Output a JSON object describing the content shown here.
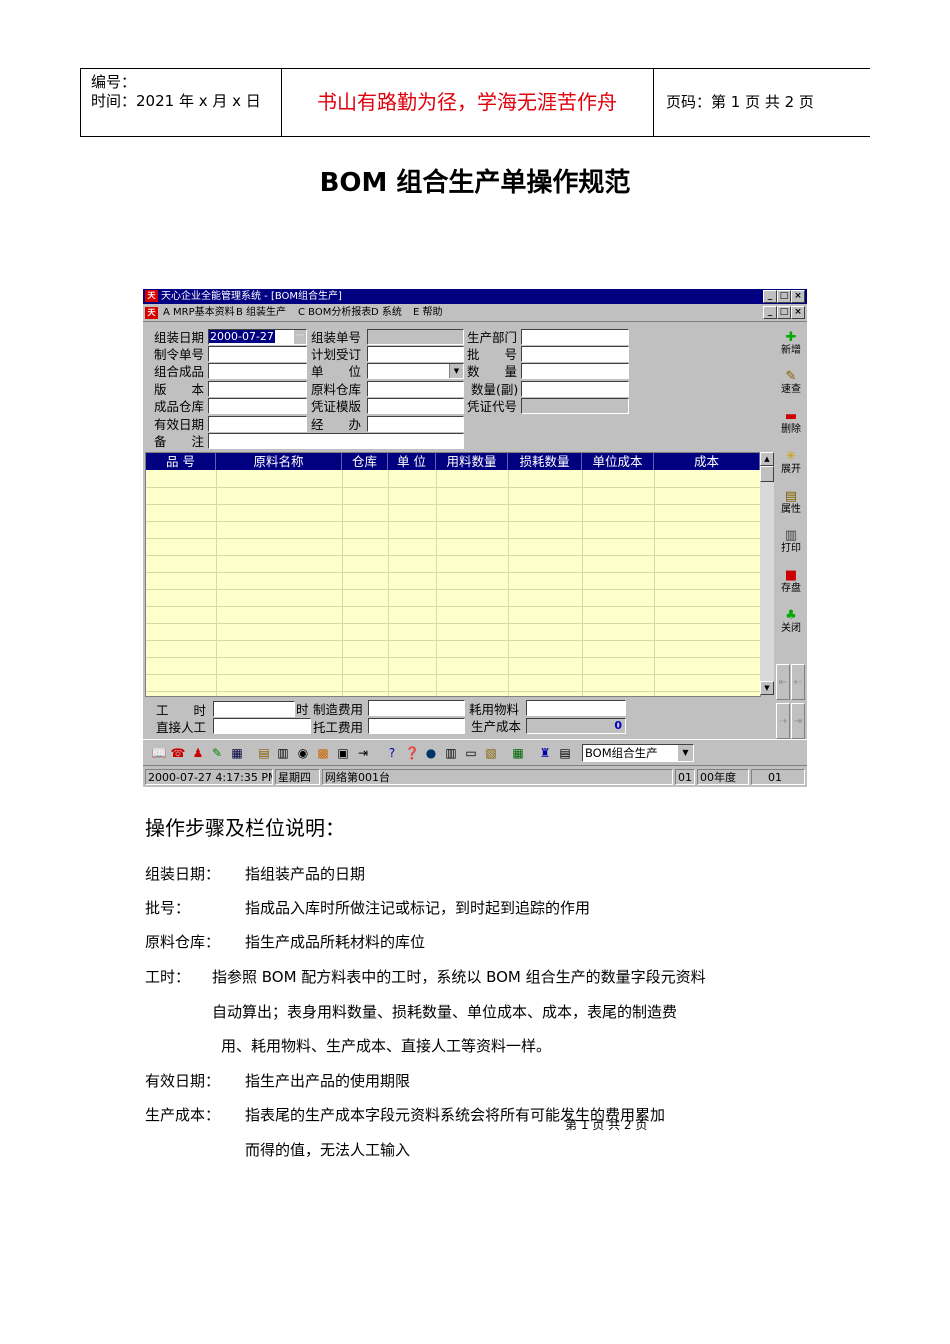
{
  "header": {
    "number_label": "编号：",
    "time_label": "时间：2021 年 x 月 x 日",
    "motto": "书山有路勤为径，学海无涯苦作舟",
    "page_info": "页码：第 1 页  共 2 页"
  },
  "title": "BOM 组合生产单操作规范",
  "app": {
    "window_title": "天心企业全能管理系统 - [BOM组合生产]",
    "window_buttons": [
      "_",
      "□",
      "×"
    ],
    "menu": [
      "A MRP基本资料",
      "B 组装生产",
      "C BOM分析报表",
      "D 系统",
      "E 帮助"
    ],
    "form": {
      "assembly_date_label": "组装日期",
      "assembly_date_value": "2000-07-27",
      "order_no_label": "制令单号",
      "product_label": "组合成品",
      "version_label": "版　　本",
      "product_wh_label": "成品仓库",
      "valid_date_label": "有效日期",
      "remark_label": "备　　注",
      "assembly_no_label": "组装单号",
      "plan_label": "计划受订",
      "unit_label": "单　　位",
      "raw_wh_label": "原料仓库",
      "voucher_tpl_label": "凭证模版",
      "handler_label": "经　　办",
      "dept_label": "生产部门",
      "batch_label": "批　　号",
      "qty_label": "数　　量",
      "qty_sub_label": "数量(副)",
      "voucher_code_label": "凭证代号"
    },
    "grid": {
      "columns": [
        "品 号",
        "原料名称",
        "仓库",
        "单 位",
        "用料数量",
        "损耗数量",
        "单位成本",
        "成本"
      ],
      "row_count": 13
    },
    "right_toolbar": [
      "新增",
      "速查",
      "删除",
      "展开",
      "属性",
      "打印",
      "存盘",
      "关闭"
    ],
    "footer": {
      "labor_hours_label": "工　　时",
      "hours_unit": "时",
      "mfg_cost_label": "制造费用",
      "material_label": "耗用物料",
      "direct_labor_label": "直接人工",
      "outsource_label": "托工费用",
      "prod_cost_label": "生产成本",
      "prod_cost_value": "0"
    },
    "combo_value": "BOM组合生产",
    "status": {
      "datetime": "2000-07-27  4:17:35 PM",
      "weekday": "星期四",
      "network": "网络第001台",
      "code1": "01",
      "year": "00年度",
      "code2": "01"
    }
  },
  "instructions": {
    "section_title": "操作步骤及栏位说明：",
    "items": [
      {
        "term": "组装日期：",
        "text": "指组装产品的日期"
      },
      {
        "term": "批号：",
        "text": "指成品入库时所做注记或标记，到时起到追踪的作用"
      },
      {
        "term": "原料仓库：",
        "text": "指生产成品所耗材料的库位"
      },
      {
        "term": "工时：",
        "text": "指参照 BOM 配方料表中的工时，系统以 BOM 组合生产的数量字段元资料"
      },
      {
        "term": "",
        "text": "自动算出；表身用料数量、损耗数量、单位成本、成本，表尾的制造费"
      },
      {
        "term": "",
        "text": "用、耗用物料、生产成本、直接人工等资料一样。"
      },
      {
        "term": "有效日期：",
        "text": "指生产出产品的使用期限"
      },
      {
        "term": "生产成本：",
        "text": "指表尾的生产成本字段元资料系统会将所有可能发生的费用累加"
      },
      {
        "term": "",
        "text": "而得的值，无法人工输入"
      }
    ],
    "page_footer": "第 1 页 共 2 页"
  }
}
